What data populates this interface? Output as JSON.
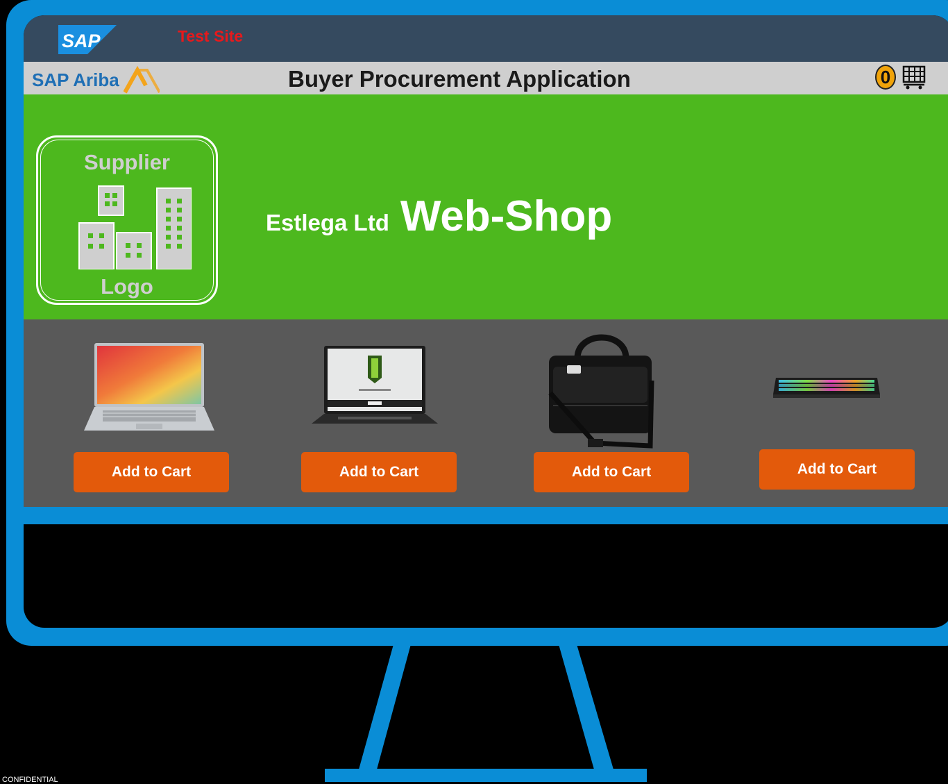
{
  "site": {
    "banner": "Test Site"
  },
  "header": {
    "brand": "SAP Ariba",
    "title": "Buyer Procurement Application",
    "cart_count": "0"
  },
  "supplier": {
    "logo_top": "Supplier",
    "logo_bottom": "Logo",
    "company": "Estlega Ltd",
    "shop_label": "Web-Shop"
  },
  "products": [
    {
      "image": "silver-laptop",
      "button": "Add to Cart"
    },
    {
      "image": "workstation-laptop",
      "button": "Add to Cart"
    },
    {
      "image": "laptop-bag",
      "button": "Add to Cart"
    },
    {
      "image": "rgb-keyboard",
      "button": "Add to Cart"
    }
  ],
  "footer": {
    "confidential": "CONFIDENTIAL"
  },
  "colors": {
    "frame": "#0a8dd6",
    "topbar": "#354a5f",
    "hero": "#4db81e",
    "products_bg": "#595959",
    "button": "#e35a0b",
    "test_site": "#e8191b"
  }
}
